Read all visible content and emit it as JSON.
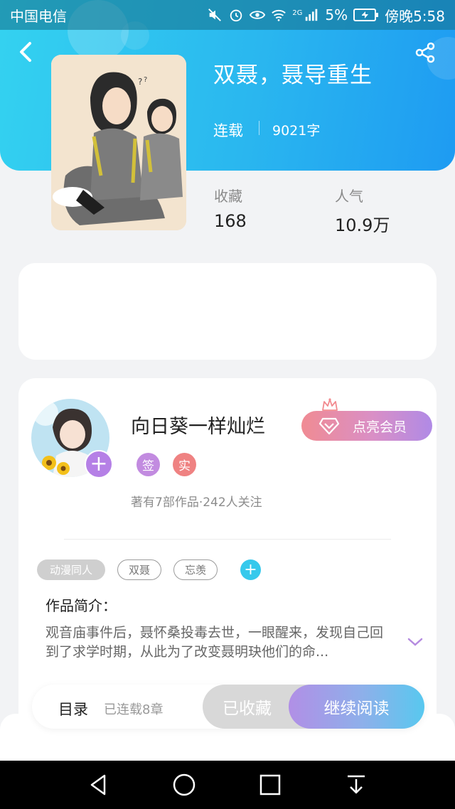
{
  "status_bar": {
    "carrier": "中国电信",
    "battery": "5%",
    "time": "傍晚5:58",
    "network": "2G"
  },
  "book": {
    "title": "双聂，聂导重生",
    "status": "连载",
    "word_count": "9021字",
    "stats": [
      {
        "label": "收藏",
        "value": "168"
      },
      {
        "label": "人气",
        "value": "10.9万"
      }
    ]
  },
  "author": {
    "name": "向日葵一样灿烂",
    "badges": [
      {
        "text": "签",
        "color": "#c28be0"
      },
      {
        "text": "实",
        "color": "#ef8282"
      }
    ],
    "stats_text": "著有7部作品·242人关注",
    "add_label": "+",
    "vip_button": "点亮会员"
  },
  "tags": [
    {
      "label": "动漫同人",
      "style": "filled"
    },
    {
      "label": "双聂",
      "style": "outline"
    },
    {
      "label": "忘羡",
      "style": "outline"
    }
  ],
  "tag_add": "+",
  "intro": {
    "label": "作品简介：",
    "text": "观音庙事件后，聂怀桑投毒去世，一眼醒来，发现自己回到了求学时期，从此为了改变聂明玦他们的命..."
  },
  "actions": {
    "toc_label": "目录",
    "toc_count": "已连载8章",
    "collected": "已收藏",
    "continue": "继续阅读"
  },
  "colors": {
    "header_start": "#34d2f0",
    "header_end": "#1e9bf2",
    "accent_purple": "#b580e6",
    "accent_blue": "#36c9ec"
  }
}
